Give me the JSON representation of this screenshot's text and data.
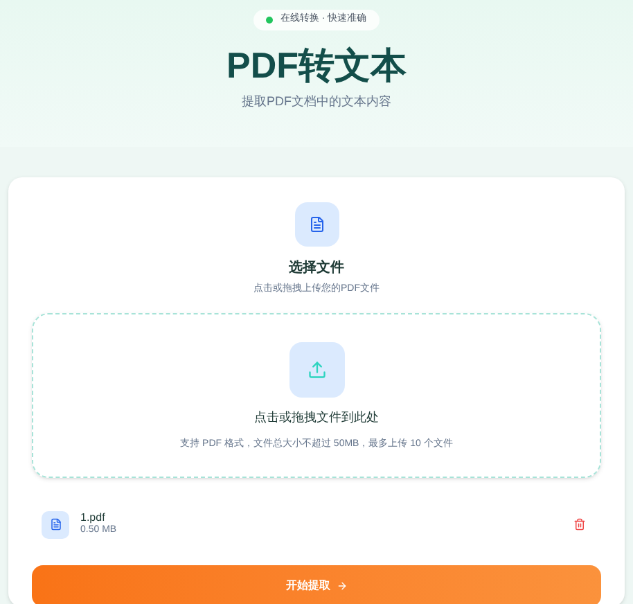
{
  "header": {
    "badge": "在线转换 · 快速准确",
    "title": "PDF转文本",
    "subtitle": "提取PDF文档中的文本内容"
  },
  "section": {
    "title": "选择文件",
    "subtitle": "点击或拖拽上传您的PDF文件"
  },
  "dropzone": {
    "title": "点击或拖拽文件到此处",
    "hint": "支持 PDF 格式，文件总大小不超过 50MB，最多上传 10 个文件"
  },
  "files": [
    {
      "name": "1.pdf",
      "size": "0.50 MB"
    }
  ],
  "start_button": {
    "label": "开始提取"
  }
}
